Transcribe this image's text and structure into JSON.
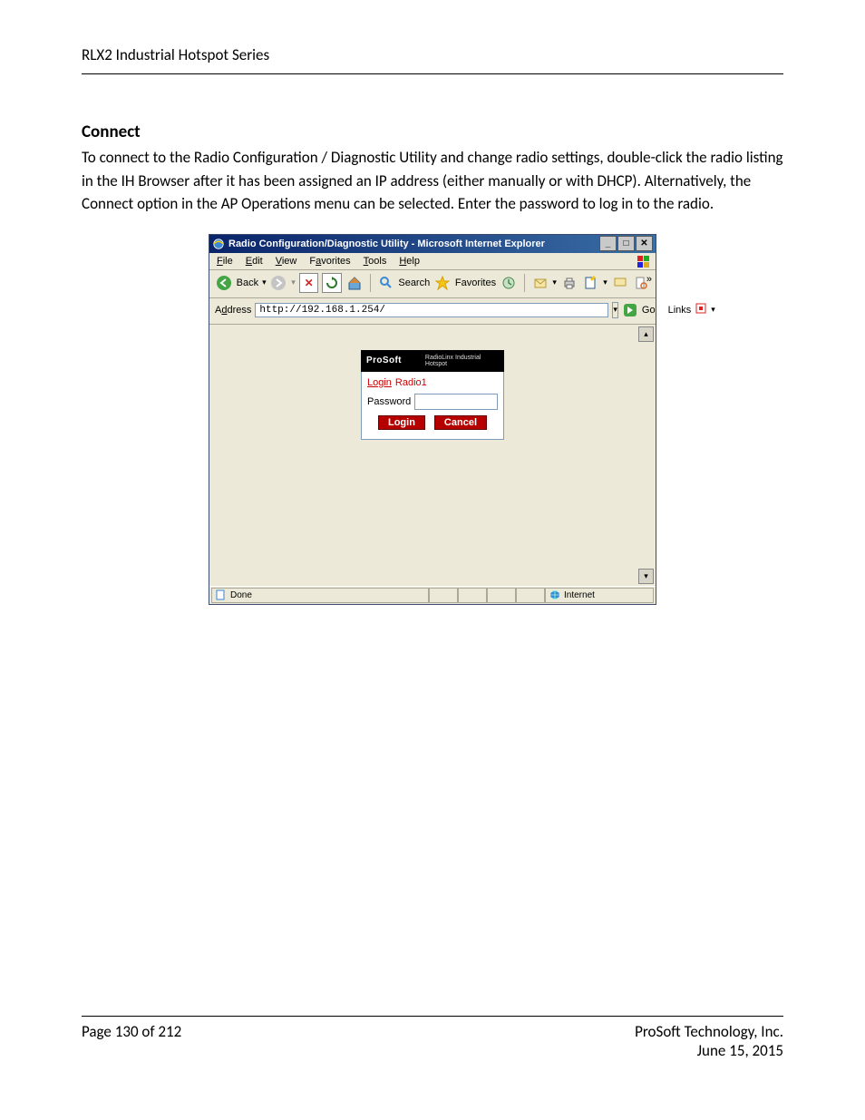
{
  "page": {
    "header_title": "RLX2 Industrial Hotspot Series",
    "section_title": "Connect",
    "body_text": "To connect to the Radio Configuration / Diagnostic Utility and change radio settings, double-click the radio listing in the IH Browser after it has been assigned an IP address (either manually or with DHCP). Alternatively, the Connect option in the AP Operations menu can be selected. Enter the password to log in to the radio.",
    "footer_left": "Page 130 of 212",
    "footer_right_1": "ProSoft Technology, Inc.",
    "footer_right_2": "June 15, 2015"
  },
  "ie": {
    "title": "Radio Configuration/Diagnostic Utility - Microsoft Internet Explorer",
    "menus": [
      "File",
      "Edit",
      "View",
      "Favorites",
      "Tools",
      "Help"
    ],
    "toolbar": {
      "back": "Back",
      "search": "Search",
      "favorites": "Favorites"
    },
    "address_label": "Address",
    "address_url": "http://192.168.1.254/",
    "go": "Go",
    "links": "Links",
    "status_done": "Done",
    "status_zone": "Internet"
  },
  "login": {
    "brand": "ProSoft",
    "product": "RadioLinx Industrial Hotspot",
    "login_label": "Login",
    "login_value": "Radio1",
    "password_label": "Password",
    "login_btn": "Login",
    "cancel_btn": "Cancel"
  }
}
